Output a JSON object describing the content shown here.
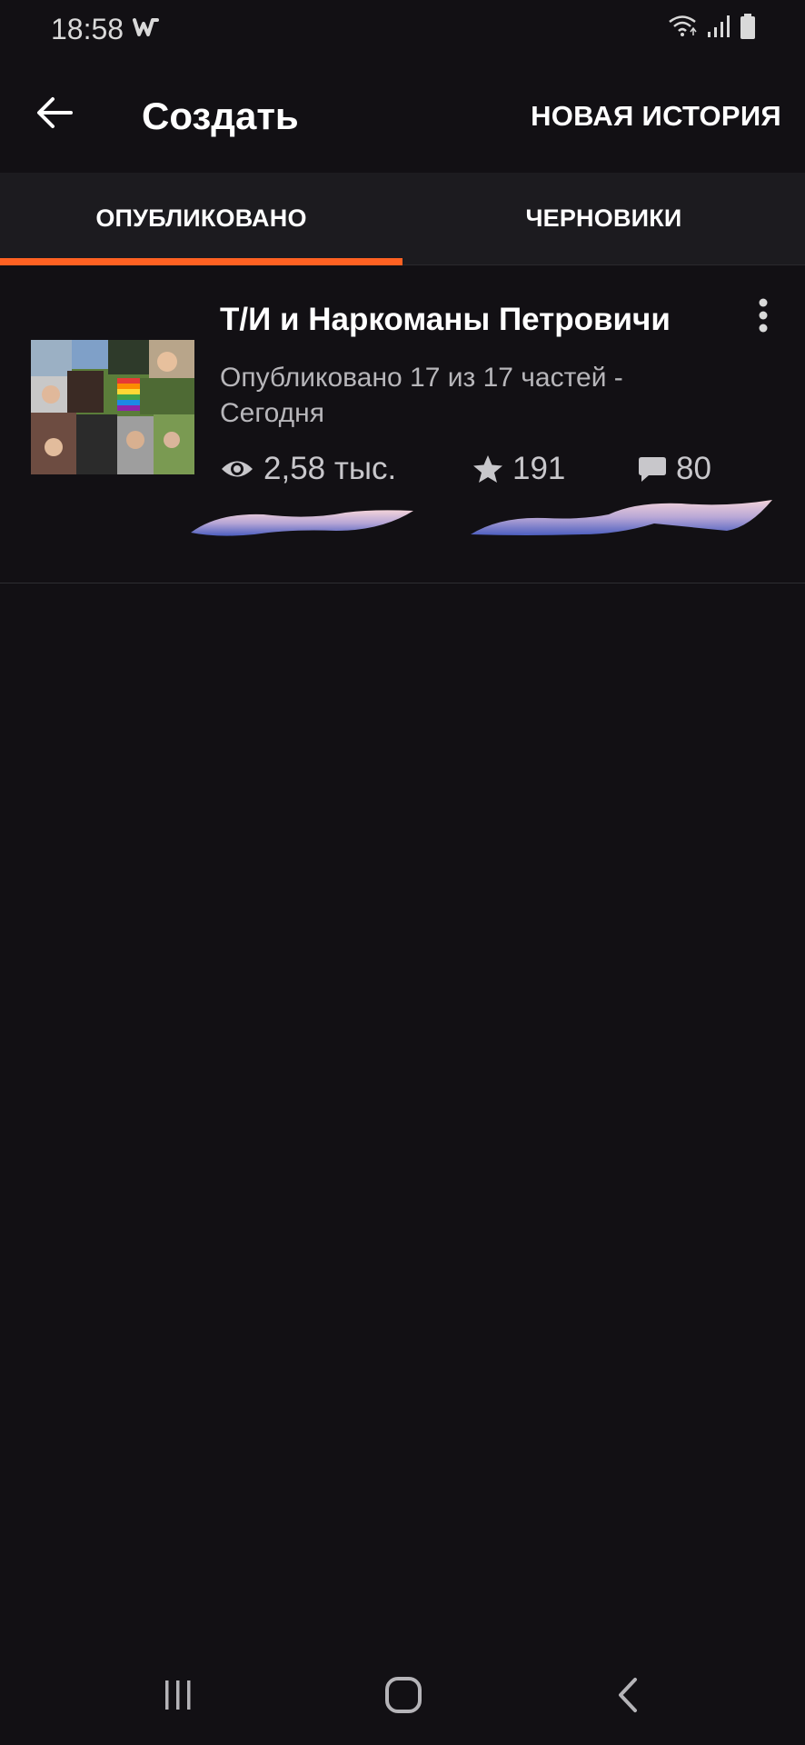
{
  "status_bar": {
    "time": "18:58",
    "app_icon": "wattpad-w-icon",
    "icons": [
      "wifi-icon",
      "signal-icon",
      "battery-icon"
    ]
  },
  "app_bar": {
    "title": "Создать",
    "back_icon": "arrow-left-icon",
    "new_story_label": "НОВАЯ ИСТОРИЯ"
  },
  "tabs": [
    {
      "label": "ОПУБЛИКОВАНО",
      "selected": true
    },
    {
      "label": "ЧЕРНОВИКИ",
      "selected": false
    }
  ],
  "accent_color": "#ff6122",
  "story": {
    "title": "Т/И и Наркоманы Петровичи",
    "meta": "Опубликовано 17 из 17 частей - Сегодня",
    "reads": "2,58 тыс.",
    "votes": "191",
    "comments": "80",
    "cover_icon": "story-cover-collage",
    "more_icon": "more-vertical-icon"
  },
  "nav_bar": {
    "icons": [
      "recent-apps-icon",
      "home-icon",
      "back-icon"
    ]
  }
}
